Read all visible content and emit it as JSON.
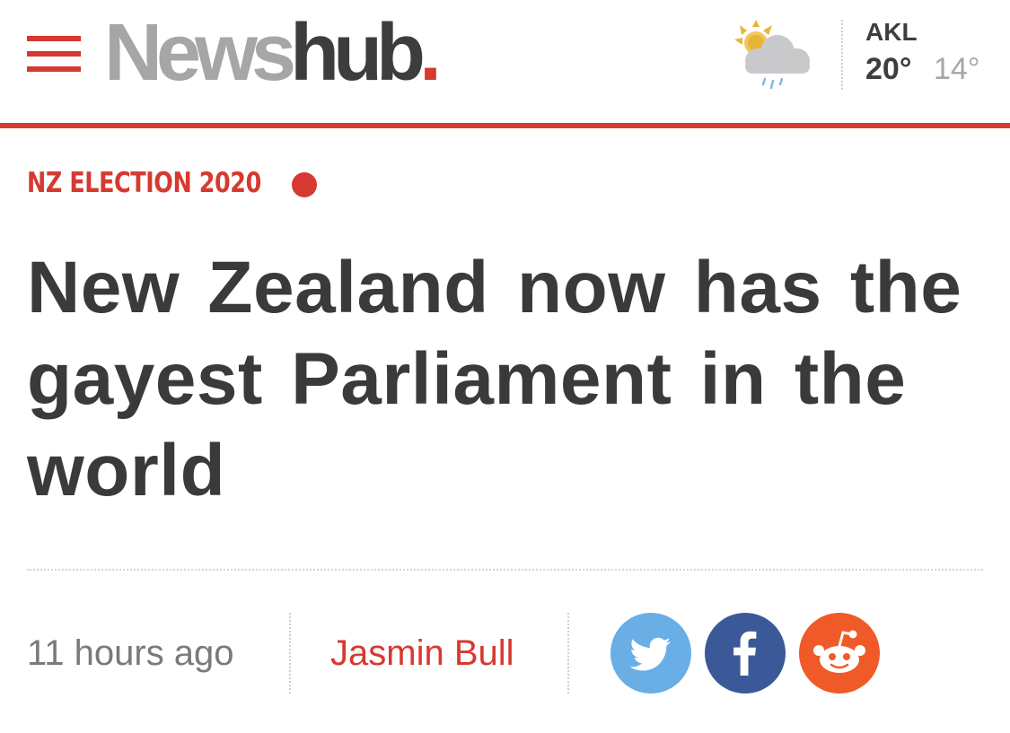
{
  "header": {
    "menu_icon": "hamburger-menu-icon",
    "logo": {
      "news": "News",
      "hub": "hub",
      "dot": "."
    },
    "weather": {
      "icon": "sun-cloud-rain-icon",
      "city": "AKL",
      "high": "20°",
      "low": "14°"
    }
  },
  "article": {
    "section": "NZ ELECTION 2020",
    "headline": "New Zealand now has the gayest Parliament in the world",
    "timestamp": "11 hours ago",
    "author": "Jasmin Bull"
  },
  "share": [
    {
      "name": "twitter",
      "icon": "twitter-bird-icon",
      "color": "#6aaee6"
    },
    {
      "name": "facebook",
      "icon": "facebook-f-icon",
      "color": "#3b5998"
    },
    {
      "name": "reddit",
      "icon": "reddit-alien-icon",
      "color": "#f05a28"
    }
  ],
  "colors": {
    "accent": "#d6392f",
    "logo_grey": "#a6a6a8",
    "text_dark": "#3a3a3c",
    "text_muted": "#7a7a7c"
  }
}
